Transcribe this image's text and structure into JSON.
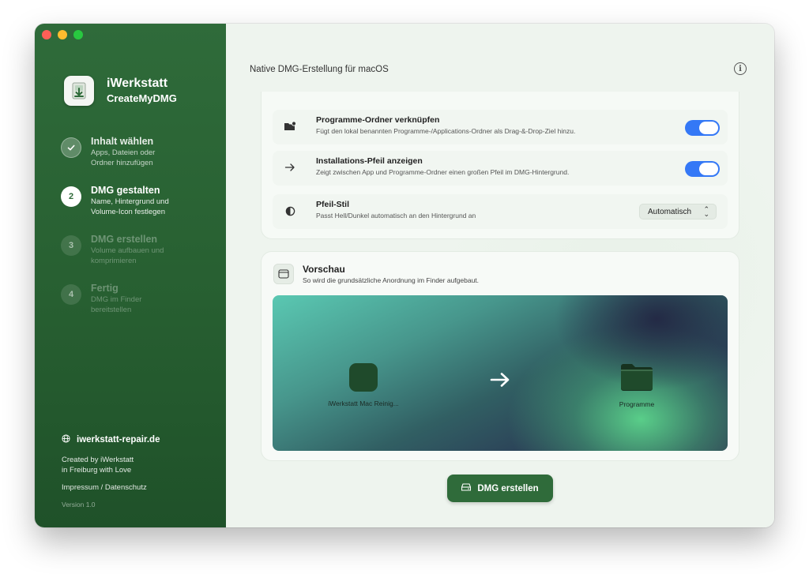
{
  "app": {
    "name": "iWerkstatt",
    "product": "CreateMyDMG"
  },
  "steps": [
    {
      "number": "1",
      "title": "Inhalt wählen",
      "desc_line1": "Apps, Dateien oder",
      "desc_line2": "Ordner hinzufügen",
      "state": "done"
    },
    {
      "number": "2",
      "title": "DMG gestalten",
      "desc_line1": "Name, Hintergrund und",
      "desc_line2": "Volume-Icon festlegen",
      "state": "active"
    },
    {
      "number": "3",
      "title": "DMG erstellen",
      "desc_line1": "Volume aufbauen und",
      "desc_line2": "komprimieren",
      "state": "pending"
    },
    {
      "number": "4",
      "title": "Fertig",
      "desc_line1": "DMG im Finder",
      "desc_line2": "bereitstellen",
      "state": "pending"
    }
  ],
  "footer": {
    "website": "iwerkstatt-repair.de",
    "credits_line1": "Created by iWerkstatt",
    "credits_line2": "in Freiburg with Love",
    "legal": "Impressum / Datenschutz",
    "version": "Version 1.0"
  },
  "main": {
    "title": "Native DMG-Erstellung für macOS"
  },
  "options": [
    {
      "title": "Programme-Ordner verknüpfen",
      "desc": "Fügt den lokal benannten Programme-/Applications-Ordner als Drag-&-Drop-Ziel hinzu.",
      "enabled": true,
      "icon": "folder-badge-icon"
    },
    {
      "title": "Installations-Pfeil anzeigen",
      "desc": "Zeigt zwischen App und Programme-Ordner einen großen Pfeil im DMG-Hintergrund.",
      "enabled": true,
      "icon": "arrow-right-icon"
    },
    {
      "title": "Pfeil-Stil",
      "desc": "Passt Hell/Dunkel automatisch an den Hintergrund an",
      "selected": "Automatisch",
      "icon": "half-circle-icon"
    }
  ],
  "preview": {
    "title": "Vorschau",
    "subtitle": "So wird die grundsätzliche Anordnung im Finder aufgebaut.",
    "app_label": "iWerkstatt Mac Reinig...",
    "folder_label": "Programme"
  },
  "actions": {
    "build_label": "DMG erstellen"
  },
  "colors": {
    "sidebar": "#2f6b3a",
    "toggle_on": "#3478f6",
    "button": "#2f6b3a"
  }
}
